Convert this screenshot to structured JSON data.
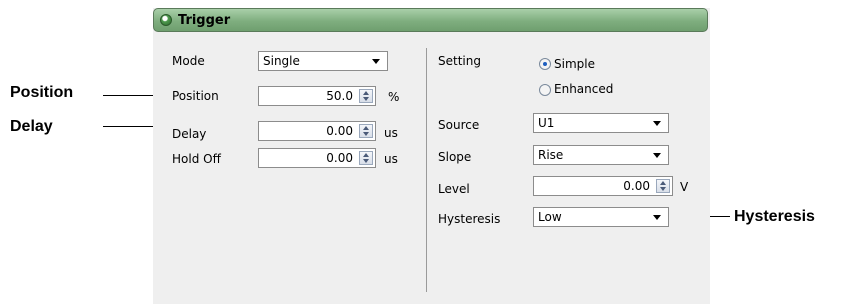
{
  "panel": {
    "title": "Trigger"
  },
  "left": {
    "mode": {
      "label": "Mode",
      "value": "Single"
    },
    "position": {
      "label": "Position",
      "value": "50.0",
      "unit": "%"
    },
    "delay": {
      "label": "Delay",
      "value": "0.00",
      "unit": "us"
    },
    "holdoff": {
      "label": "Hold Off",
      "value": "0.00",
      "unit": "us"
    }
  },
  "right": {
    "setting": {
      "label": "Setting",
      "options": [
        "Simple",
        "Enhanced"
      ],
      "selected": "Simple"
    },
    "source": {
      "label": "Source",
      "value": "U1"
    },
    "slope": {
      "label": "Slope",
      "value": "Rise"
    },
    "level": {
      "label": "Level",
      "value": "0.00",
      "unit": "V"
    },
    "hysteresis": {
      "label": "Hysteresis",
      "value": "Low"
    }
  },
  "callouts": {
    "position": "Position",
    "delay": "Delay",
    "hysteresis": "Hysteresis"
  }
}
